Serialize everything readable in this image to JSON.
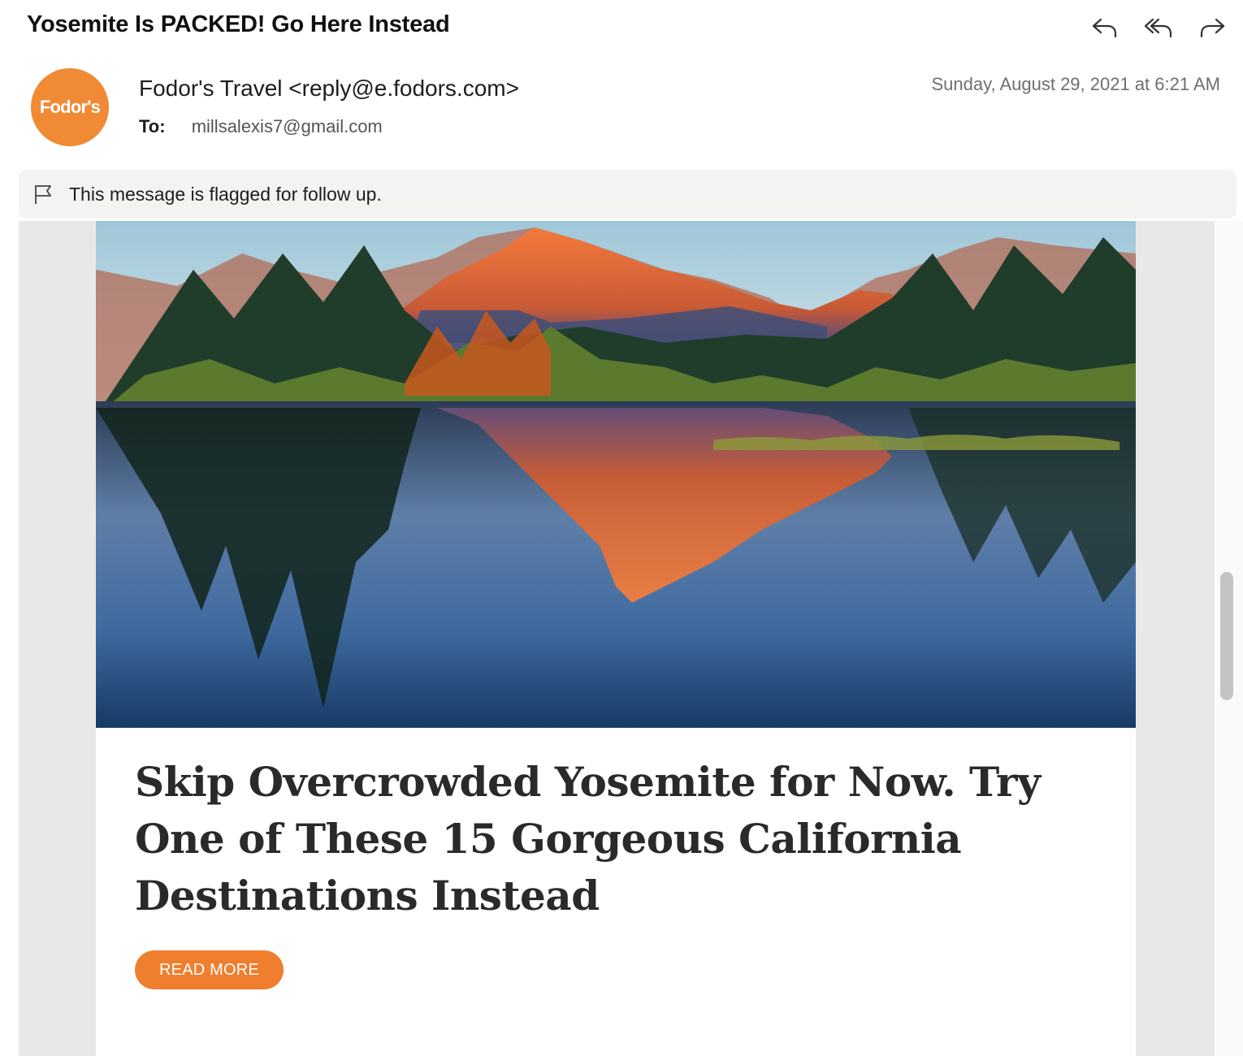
{
  "message": {
    "subject": "Yosemite Is PACKED! Go Here Instead",
    "sender_logo_text": "Fodor's",
    "from": "Fodor's Travel <reply@e.fodors.com>",
    "to_label": "To:",
    "to_address": "millsalexis7@gmail.com",
    "date": "Sunday, August 29, 2021 at 6:21 AM",
    "flag_notice": "This message is flagged for follow up."
  },
  "toolbar": {
    "icons": [
      "reply-icon",
      "reply-all-icon",
      "forward-icon"
    ]
  },
  "content": {
    "headline": "Skip Overcrowded Yosemite for Now. Try One of These 15 Gorgeous California Destinations Instead",
    "cta_label": "READ MORE"
  },
  "colors": {
    "brand_orange": "#f08a34",
    "cta_orange": "#f07e2f",
    "flag_bar_bg": "#f3f3f1",
    "body_bg": "#e8e8e8"
  }
}
